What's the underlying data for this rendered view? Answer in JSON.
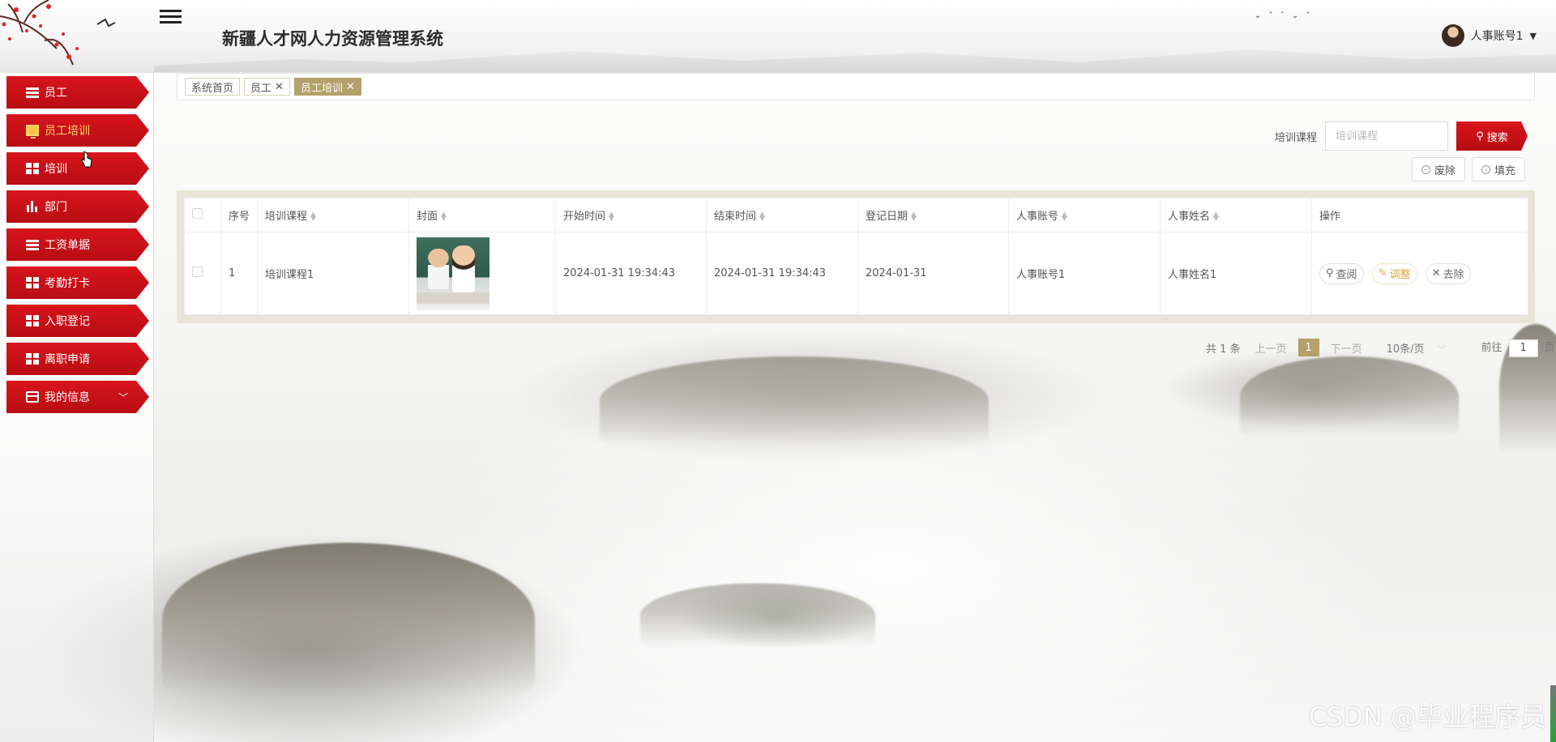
{
  "app": {
    "title": "新疆人才网人力资源管理系统",
    "user_name": "人事账号1"
  },
  "sidebar": {
    "items": [
      {
        "label": "员工",
        "icon": "list-icon",
        "active": false
      },
      {
        "label": "员工培训",
        "icon": "monitor-icon",
        "active": true
      },
      {
        "label": "培训",
        "icon": "grid-icon",
        "active": false
      },
      {
        "label": "部门",
        "icon": "bar-chart-icon",
        "active": false
      },
      {
        "label": "工资单据",
        "icon": "list-icon",
        "active": false
      },
      {
        "label": "考勤打卡",
        "icon": "grid-icon",
        "active": false
      },
      {
        "label": "入职登记",
        "icon": "grid-icon",
        "active": false
      },
      {
        "label": "离职申请",
        "icon": "grid-icon",
        "active": false
      },
      {
        "label": "我的信息",
        "icon": "card-icon",
        "active": false,
        "expandable": true
      }
    ]
  },
  "tabs": [
    {
      "label": "系统首页",
      "closable": false,
      "active": false
    },
    {
      "label": "员工",
      "closable": true,
      "active": false
    },
    {
      "label": "员工培训",
      "closable": true,
      "active": true
    }
  ],
  "search": {
    "label": "培训课程",
    "placeholder": "培训课程",
    "value": "",
    "button_label": "搜索"
  },
  "actions": {
    "discard_label": "废除",
    "fill_label": "填充"
  },
  "table": {
    "columns": [
      "序号",
      "培训课程",
      "封面",
      "开始时间",
      "结束时间",
      "登记日期",
      "人事账号",
      "人事姓名",
      "操作"
    ],
    "rows": [
      {
        "index": "1",
        "course": "培训课程1",
        "start_time": "2024-01-31 19:34:43",
        "end_time": "2024-01-31 19:34:43",
        "register_date": "2024-01-31",
        "hr_account": "人事账号1",
        "hr_name": "人事姓名1",
        "ops": {
          "view": "查阅",
          "edit": "调整",
          "delete": "去除"
        }
      }
    ]
  },
  "pagination": {
    "total": "共 1 条",
    "prev": "上一页",
    "current_page": "1",
    "next": "下一页",
    "page_size": "10条/页",
    "goto_label": "前往",
    "goto_value": "1",
    "goto_suffix": "页"
  },
  "watermark": "CSDN @毕业程序员",
  "colors": {
    "accent_red": "#c8111a",
    "tab_active": "#b4a06a",
    "edit_orange": "#e6a23c"
  }
}
